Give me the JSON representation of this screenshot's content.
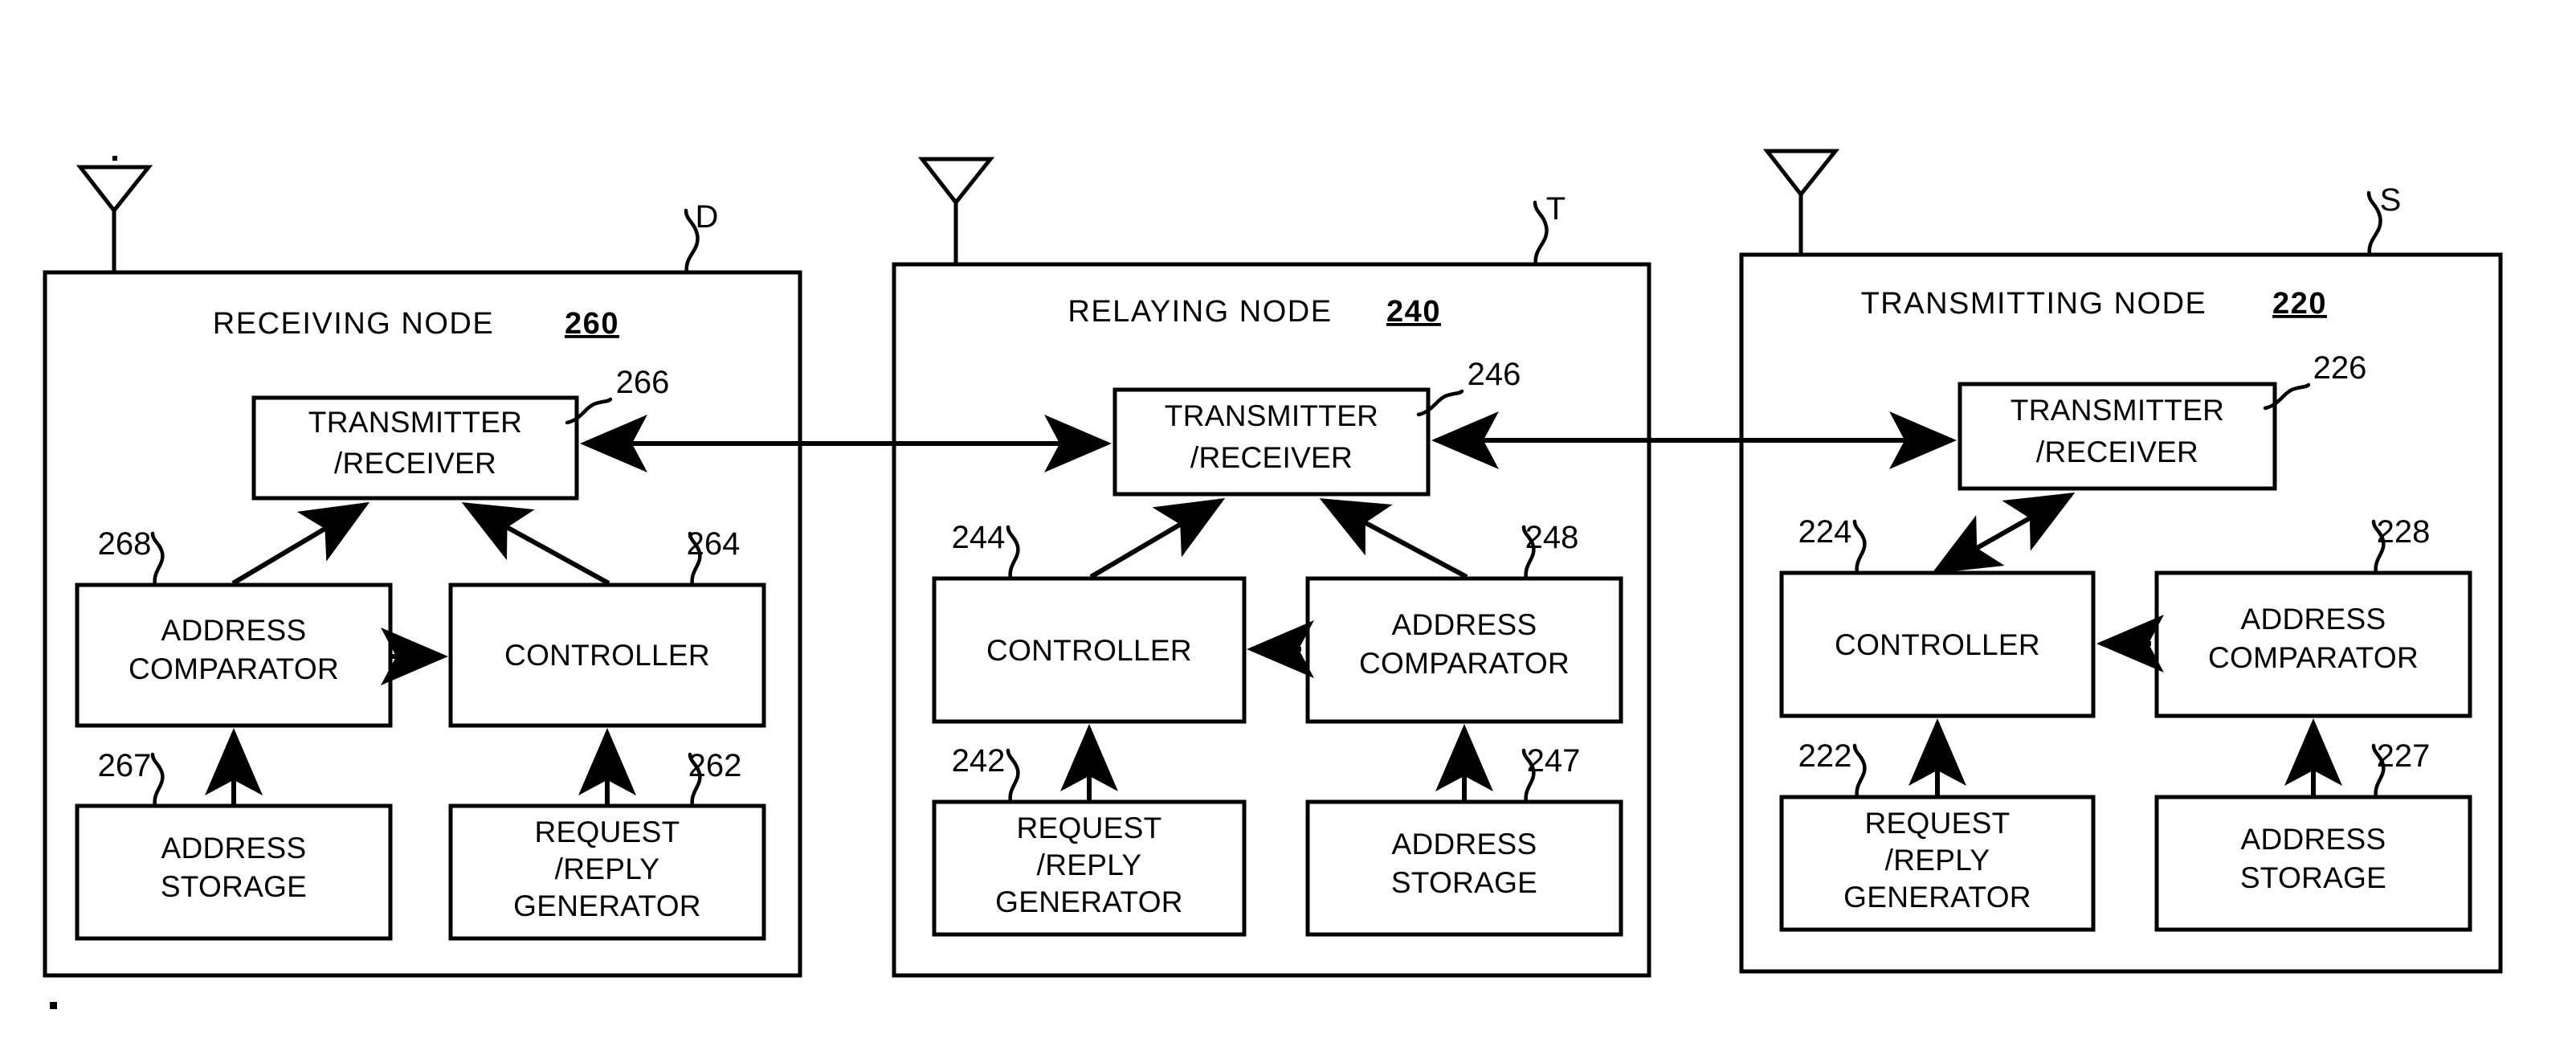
{
  "figure": {
    "kind": "patent-block-diagram",
    "background_color": "#ffffff",
    "line_color": "#000000"
  },
  "nodes": [
    {
      "id": "receiving",
      "tag": "D",
      "title": "RECEIVING NODE",
      "number": "260",
      "units": [
        {
          "key": "txrx",
          "ref": "266",
          "lines": [
            "TRANSMITTER",
            "/RECEIVER"
          ]
        },
        {
          "key": "cmp",
          "ref": "268",
          "lines": [
            "ADDRESS",
            "COMPARATOR"
          ]
        },
        {
          "key": "ctrl",
          "ref": "264",
          "lines": [
            "CONTROLLER"
          ]
        },
        {
          "key": "store",
          "ref": "267",
          "lines": [
            "ADDRESS",
            "STORAGE"
          ]
        },
        {
          "key": "gen",
          "ref": "262",
          "lines": [
            "REQUEST",
            "/REPLY",
            "GENERATOR"
          ]
        }
      ]
    },
    {
      "id": "relaying",
      "tag": "T",
      "title": "RELAYING NODE",
      "number": "240",
      "units": [
        {
          "key": "txrx",
          "ref": "246",
          "lines": [
            "TRANSMITTER",
            "/RECEIVER"
          ]
        },
        {
          "key": "ctrl",
          "ref": "244",
          "lines": [
            "CONTROLLER"
          ]
        },
        {
          "key": "cmp",
          "ref": "248",
          "lines": [
            "ADDRESS",
            "COMPARATOR"
          ]
        },
        {
          "key": "gen",
          "ref": "242",
          "lines": [
            "REQUEST",
            "/REPLY",
            "GENERATOR"
          ]
        },
        {
          "key": "store",
          "ref": "247",
          "lines": [
            "ADDRESS",
            "STORAGE"
          ]
        }
      ]
    },
    {
      "id": "transmitting",
      "tag": "S",
      "title": "TRANSMITTING NODE",
      "number": "220",
      "units": [
        {
          "key": "txrx",
          "ref": "226",
          "lines": [
            "TRANSMITTER",
            "/RECEIVER"
          ]
        },
        {
          "key": "ctrl",
          "ref": "224",
          "lines": [
            "CONTROLLER"
          ]
        },
        {
          "key": "cmp",
          "ref": "228",
          "lines": [
            "ADDRESS",
            "COMPARATOR"
          ]
        },
        {
          "key": "gen",
          "ref": "222",
          "lines": [
            "REQUEST",
            "/REPLY",
            "GENERATOR"
          ]
        },
        {
          "key": "store",
          "ref": "227",
          "lines": [
            "ADDRESS",
            "STORAGE"
          ]
        }
      ]
    }
  ],
  "links": {
    "receiving_relaying": "bidirectional",
    "relaying_transmitting": "bidirectional"
  },
  "text": {
    "n0_title": "RECEIVING NODE",
    "n0_num": "260",
    "n0_tag": "D",
    "n0_txrx_1": "TRANSMITTER",
    "n0_txrx_2": "/RECEIVER",
    "n0_txrx_ref": "266",
    "n0_cmp_1": "ADDRESS",
    "n0_cmp_2": "COMPARATOR",
    "n0_cmp_ref": "268",
    "n0_ctrl_1": "CONTROLLER",
    "n0_ctrl_ref": "264",
    "n0_store_1": "ADDRESS",
    "n0_store_2": "STORAGE",
    "n0_store_ref": "267",
    "n0_gen_1": "REQUEST",
    "n0_gen_2": "/REPLY",
    "n0_gen_3": "GENERATOR",
    "n0_gen_ref": "262",
    "n1_title": "RELAYING NODE",
    "n1_num": "240",
    "n1_tag": "T",
    "n1_txrx_1": "TRANSMITTER",
    "n1_txrx_2": "/RECEIVER",
    "n1_txrx_ref": "246",
    "n1_ctrl_1": "CONTROLLER",
    "n1_ctrl_ref": "244",
    "n1_cmp_1": "ADDRESS",
    "n1_cmp_2": "COMPARATOR",
    "n1_cmp_ref": "248",
    "n1_gen_1": "REQUEST",
    "n1_gen_2": "/REPLY",
    "n1_gen_3": "GENERATOR",
    "n1_gen_ref": "242",
    "n1_store_1": "ADDRESS",
    "n1_store_2": "STORAGE",
    "n1_store_ref": "247",
    "n2_title": "TRANSMITTING NODE",
    "n2_num": "220",
    "n2_tag": "S",
    "n2_txrx_1": "TRANSMITTER",
    "n2_txrx_2": "/RECEIVER",
    "n2_txrx_ref": "226",
    "n2_ctrl_1": "CONTROLLER",
    "n2_ctrl_ref": "224",
    "n2_cmp_1": "ADDRESS",
    "n2_cmp_2": "COMPARATOR",
    "n2_cmp_ref": "228",
    "n2_gen_1": "REQUEST",
    "n2_gen_2": "/REPLY",
    "n2_gen_3": "GENERATOR",
    "n2_gen_ref": "222",
    "n2_store_1": "ADDRESS",
    "n2_store_2": "STORAGE",
    "n2_store_ref": "227"
  }
}
